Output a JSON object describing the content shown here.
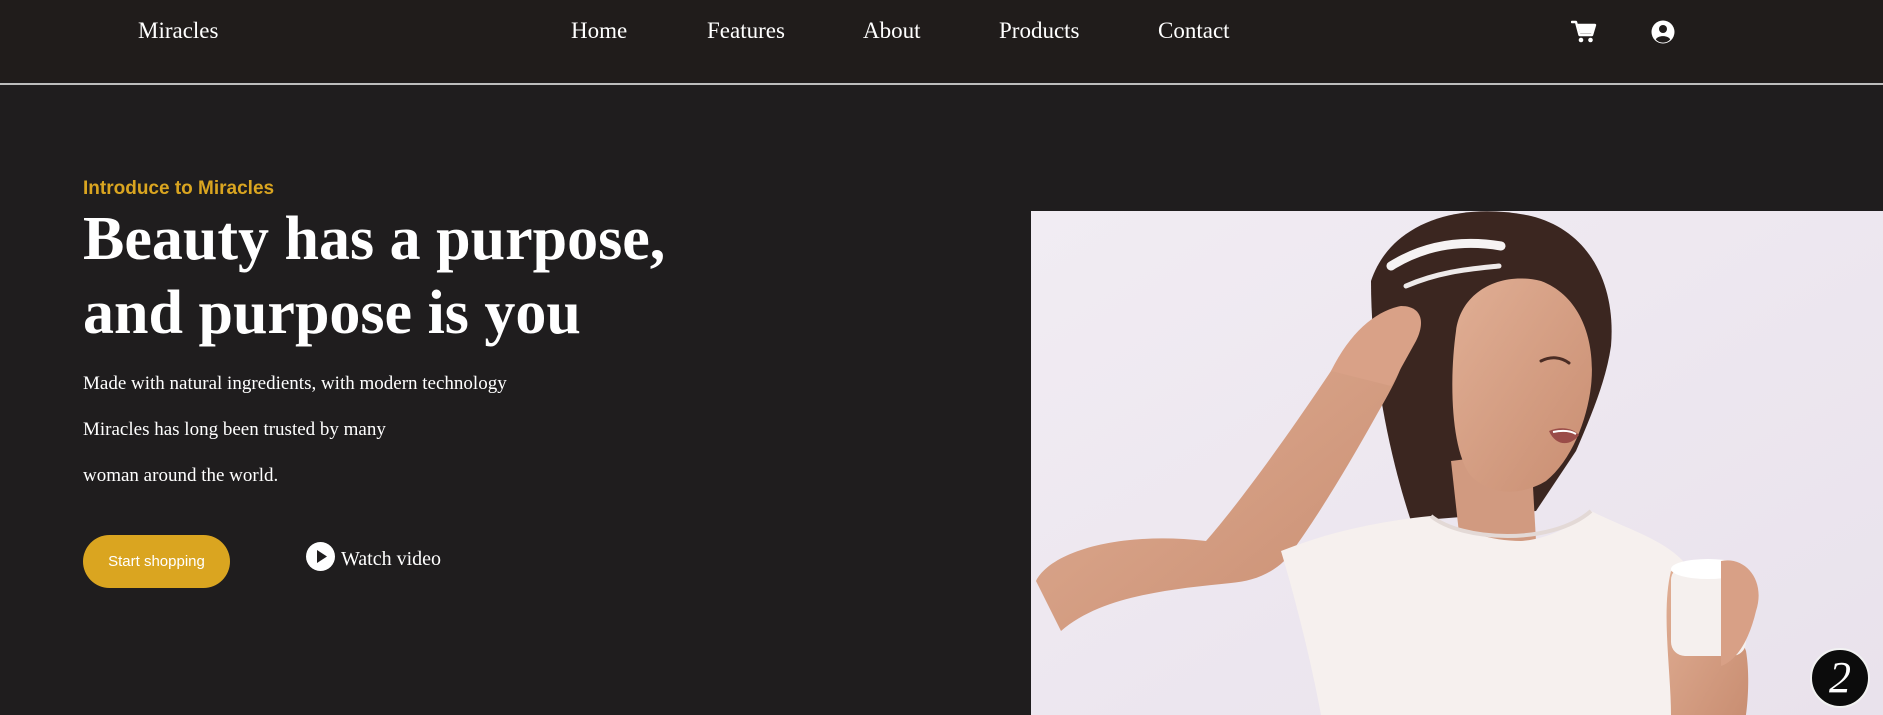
{
  "brand": {
    "name": "Miracles"
  },
  "nav": {
    "items": [
      {
        "label": "Home"
      },
      {
        "label": "Features"
      },
      {
        "label": "About"
      },
      {
        "label": "Products"
      },
      {
        "label": "Contact"
      }
    ],
    "icons": [
      "cart-icon",
      "user-icon"
    ]
  },
  "hero": {
    "eyebrow": "Introduce to Miracles",
    "headline_lines": [
      "Beauty has a purpose,",
      "and purpose is you"
    ],
    "description_lines": [
      "Made with natural ingredients, with modern technology",
      "Miracles has long been trusted by many",
      "woman around the world."
    ],
    "primary_button": "Start shopping",
    "secondary_button": "Watch video",
    "secondary_icon": "play-icon"
  },
  "badge": {
    "text": "2"
  },
  "colors": {
    "background": "#1f1d1e",
    "accent": "#daa520",
    "text": "#ffffff"
  }
}
